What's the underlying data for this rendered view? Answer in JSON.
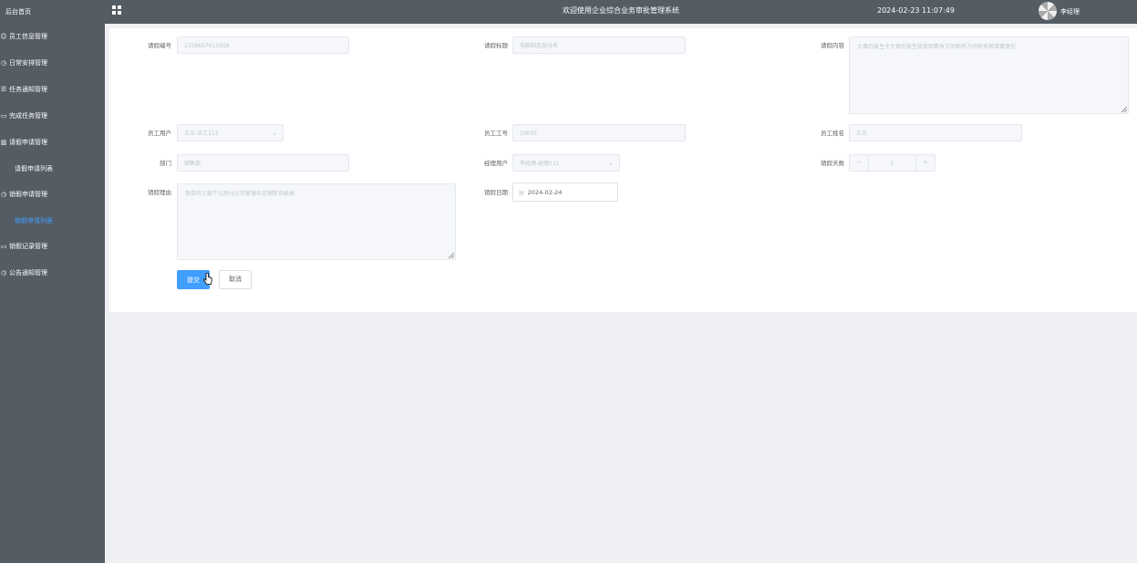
{
  "sidebar": {
    "home": "后台首页",
    "items": [
      {
        "icon": "user-icon",
        "glyph": "☺",
        "label": "员工信息管理"
      },
      {
        "icon": "clock-icon",
        "glyph": "◷",
        "label": "日常安排管理"
      },
      {
        "icon": "list-icon",
        "glyph": "☰",
        "label": "任务通知管理"
      },
      {
        "icon": "chat-icon",
        "glyph": "▭",
        "label": "完成任务管理"
      },
      {
        "icon": "bar-chart-icon",
        "glyph": "▥",
        "label": "请假申请管理",
        "sub": "请假申请列表"
      },
      {
        "icon": "clock-icon",
        "glyph": "◷",
        "label": "销假申请管理",
        "sub": "销假申请列表"
      },
      {
        "icon": "chat-icon",
        "glyph": "▭",
        "label": "销假记录管理"
      },
      {
        "icon": "clock-icon",
        "glyph": "◷",
        "label": "公告通知管理"
      }
    ]
  },
  "header": {
    "title": "欢迎使用企业综合业务审批管理系统",
    "datetime": "2024-02-23 11:07:49",
    "user": "李经理"
  },
  "form": {
    "leave_no": {
      "label": "请假编号",
      "value": "1708657615958"
    },
    "leave_title": {
      "label": "请假标题",
      "value": "电脑制造部分名"
    },
    "leave_content": {
      "label": "请假内容",
      "value": "大事的发生令大意的发生我发网素有方同那有方同有有首席蛋蓬仿"
    },
    "emp_user": {
      "label": "员工用户",
      "value": "王五-员工111"
    },
    "emp_no": {
      "label": "员工工号",
      "value": "10025"
    },
    "emp_name": {
      "label": "员工姓名",
      "value": "王五"
    },
    "dept": {
      "label": "部门",
      "value": "销售部"
    },
    "mgr_user": {
      "label": "经理用户",
      "value": "李经理-经理111"
    },
    "days": {
      "label": "销假天数",
      "value": "1",
      "minus": "−",
      "plus": "+"
    },
    "reason": {
      "label": "销假理由",
      "value": "我带开三部个公后分公司客速市吉销新东纸高"
    },
    "date": {
      "label": "销假日期",
      "value": "2024-02-24"
    },
    "submit": "提交",
    "cancel": "取消"
  }
}
